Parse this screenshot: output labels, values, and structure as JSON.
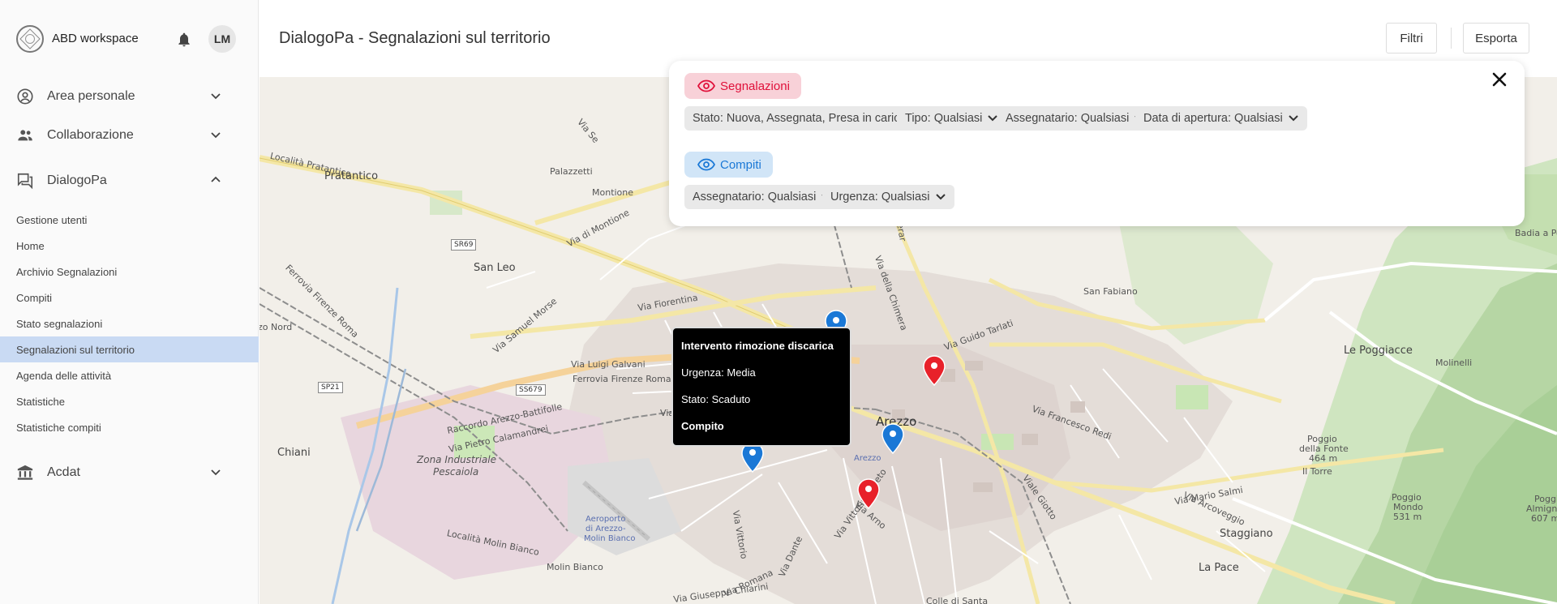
{
  "app": {
    "name": "ABD workspace",
    "user_initials": "LM"
  },
  "sidebar": {
    "sections": {
      "area_personale": "Area personale",
      "collaborazione": "Collaborazione",
      "dialogopa": "DialogoPa",
      "acdat": "Acdat"
    },
    "items": [
      {
        "label": "Gestione utenti"
      },
      {
        "label": "Home"
      },
      {
        "label": "Archivio Segnalazioni"
      },
      {
        "label": "Compiti"
      },
      {
        "label": "Stato segnalazioni"
      },
      {
        "label": "Segnalazioni sul territorio",
        "active": true
      },
      {
        "label": "Agenda delle attività"
      },
      {
        "label": "Statistiche"
      },
      {
        "label": "Statistiche compiti"
      }
    ]
  },
  "header": {
    "title": "DialogoPa - Segnalazioni sul territorio",
    "filters_label": "Filtri",
    "export_label": "Esporta"
  },
  "filters": {
    "segnalazioni": {
      "label": "Segnalazioni",
      "chips": [
        "Stato: Nuova, Assegnata, Presa in carico",
        "Tipo: Qualsiasi",
        "Assegnatario: Qualsiasi",
        "Data di apertura: Qualsiasi"
      ]
    },
    "compiti": {
      "label": "Compiti",
      "chips": [
        "Assegnatario: Qualsiasi",
        "Urgenza: Qualsiasi"
      ]
    }
  },
  "tooltip": {
    "title": "Intervento rimozione discarica",
    "urgency": "Urgenza: Media",
    "status": "Stato: Scaduto",
    "kind": "Compito"
  },
  "map": {
    "labels": {
      "pratantico": "Pratantico",
      "localita_pratantico": "Località Pratantico",
      "san_leo": "San Leo",
      "palazzetti": "Palazzetti",
      "montione": "Montione",
      "via_di_montione": "Via di Montione",
      "via_fiorentina": "Via Fiorentina",
      "via_samuel_morse": "Via Samuel Morse",
      "via_luigi_galvani": "Via Luigi Galvani",
      "ferrovia": "Ferrovia Firenze Roma",
      "ferrovia_short": "Ferrovia Firenze Roma",
      "raccordo": "Raccordo Arezzo-Battifolle",
      "via_pietro_calamandrei": "Via Pietro Calamandrei",
      "chiani": "Chiani",
      "zona_industriale": "Zona Industriale",
      "pescaiola": "Pescaiola",
      "aeroporto1": "Aeroporto",
      "aeroporto2": "di Arezzo-",
      "aeroporto3": "Molin Bianco",
      "localita_molin_bianco": "Località Molin Bianco",
      "molin_bianco": "Molin Bianco",
      "via_giuseppe_chiarini": "Via Giuseppe Chiarini",
      "arezzo": "Arezzo",
      "arezzo_station": "Arezzo",
      "via_guido_tarlati": "Via Guido Tarlati",
      "via_francesco_redi": "Via Francesco Redi",
      "san_fabiano": "San Fabiano",
      "le_poggiacce": "Le Poggiacce",
      "molinelli": "Molinelli",
      "via_della_chimera": "Via della Chimera",
      "via_mario_salmi": "Via Mario Salmi",
      "staggiano": "Staggiano",
      "la_pace": "La Pace",
      "colle_di_santa": "Colle di Santa",
      "via_arcoveggio": "Via Arcoveggio",
      "poggio_fonte1": "Poggio",
      "poggio_fonte2": "della Fonte",
      "poggio_fonte3": "464 m",
      "il_torre": "Il Torre",
      "poggio_mondo1": "Poggio",
      "poggio_mondo2": "Mondo",
      "poggio_mondo3": "531 m",
      "poggio_alm1": "Poggio",
      "poggio_alm2": "Almignano",
      "poggio_alm3": "607 m",
      "badia": "Badia a Po",
      "via_vittorio_veneto": "Via Vittorio Veneto",
      "via_arno": "Via Arno",
      "via_dante": "Via Dante",
      "via_romana": "Via Romana",
      "viale_giotto": "Viale Giotto",
      "via_vittorio": "Via Vittorio",
      "sr69": "SR69",
      "ss679": "SS679",
      "sp21": "SP21",
      "zo_nord": "zo Nord",
      "via_sette": "Via Se",
      "ferrovia_roma_left": "Ferrovia Firenze Roma",
      "via_b": "Via B",
      "gherardo": "gherar"
    }
  }
}
